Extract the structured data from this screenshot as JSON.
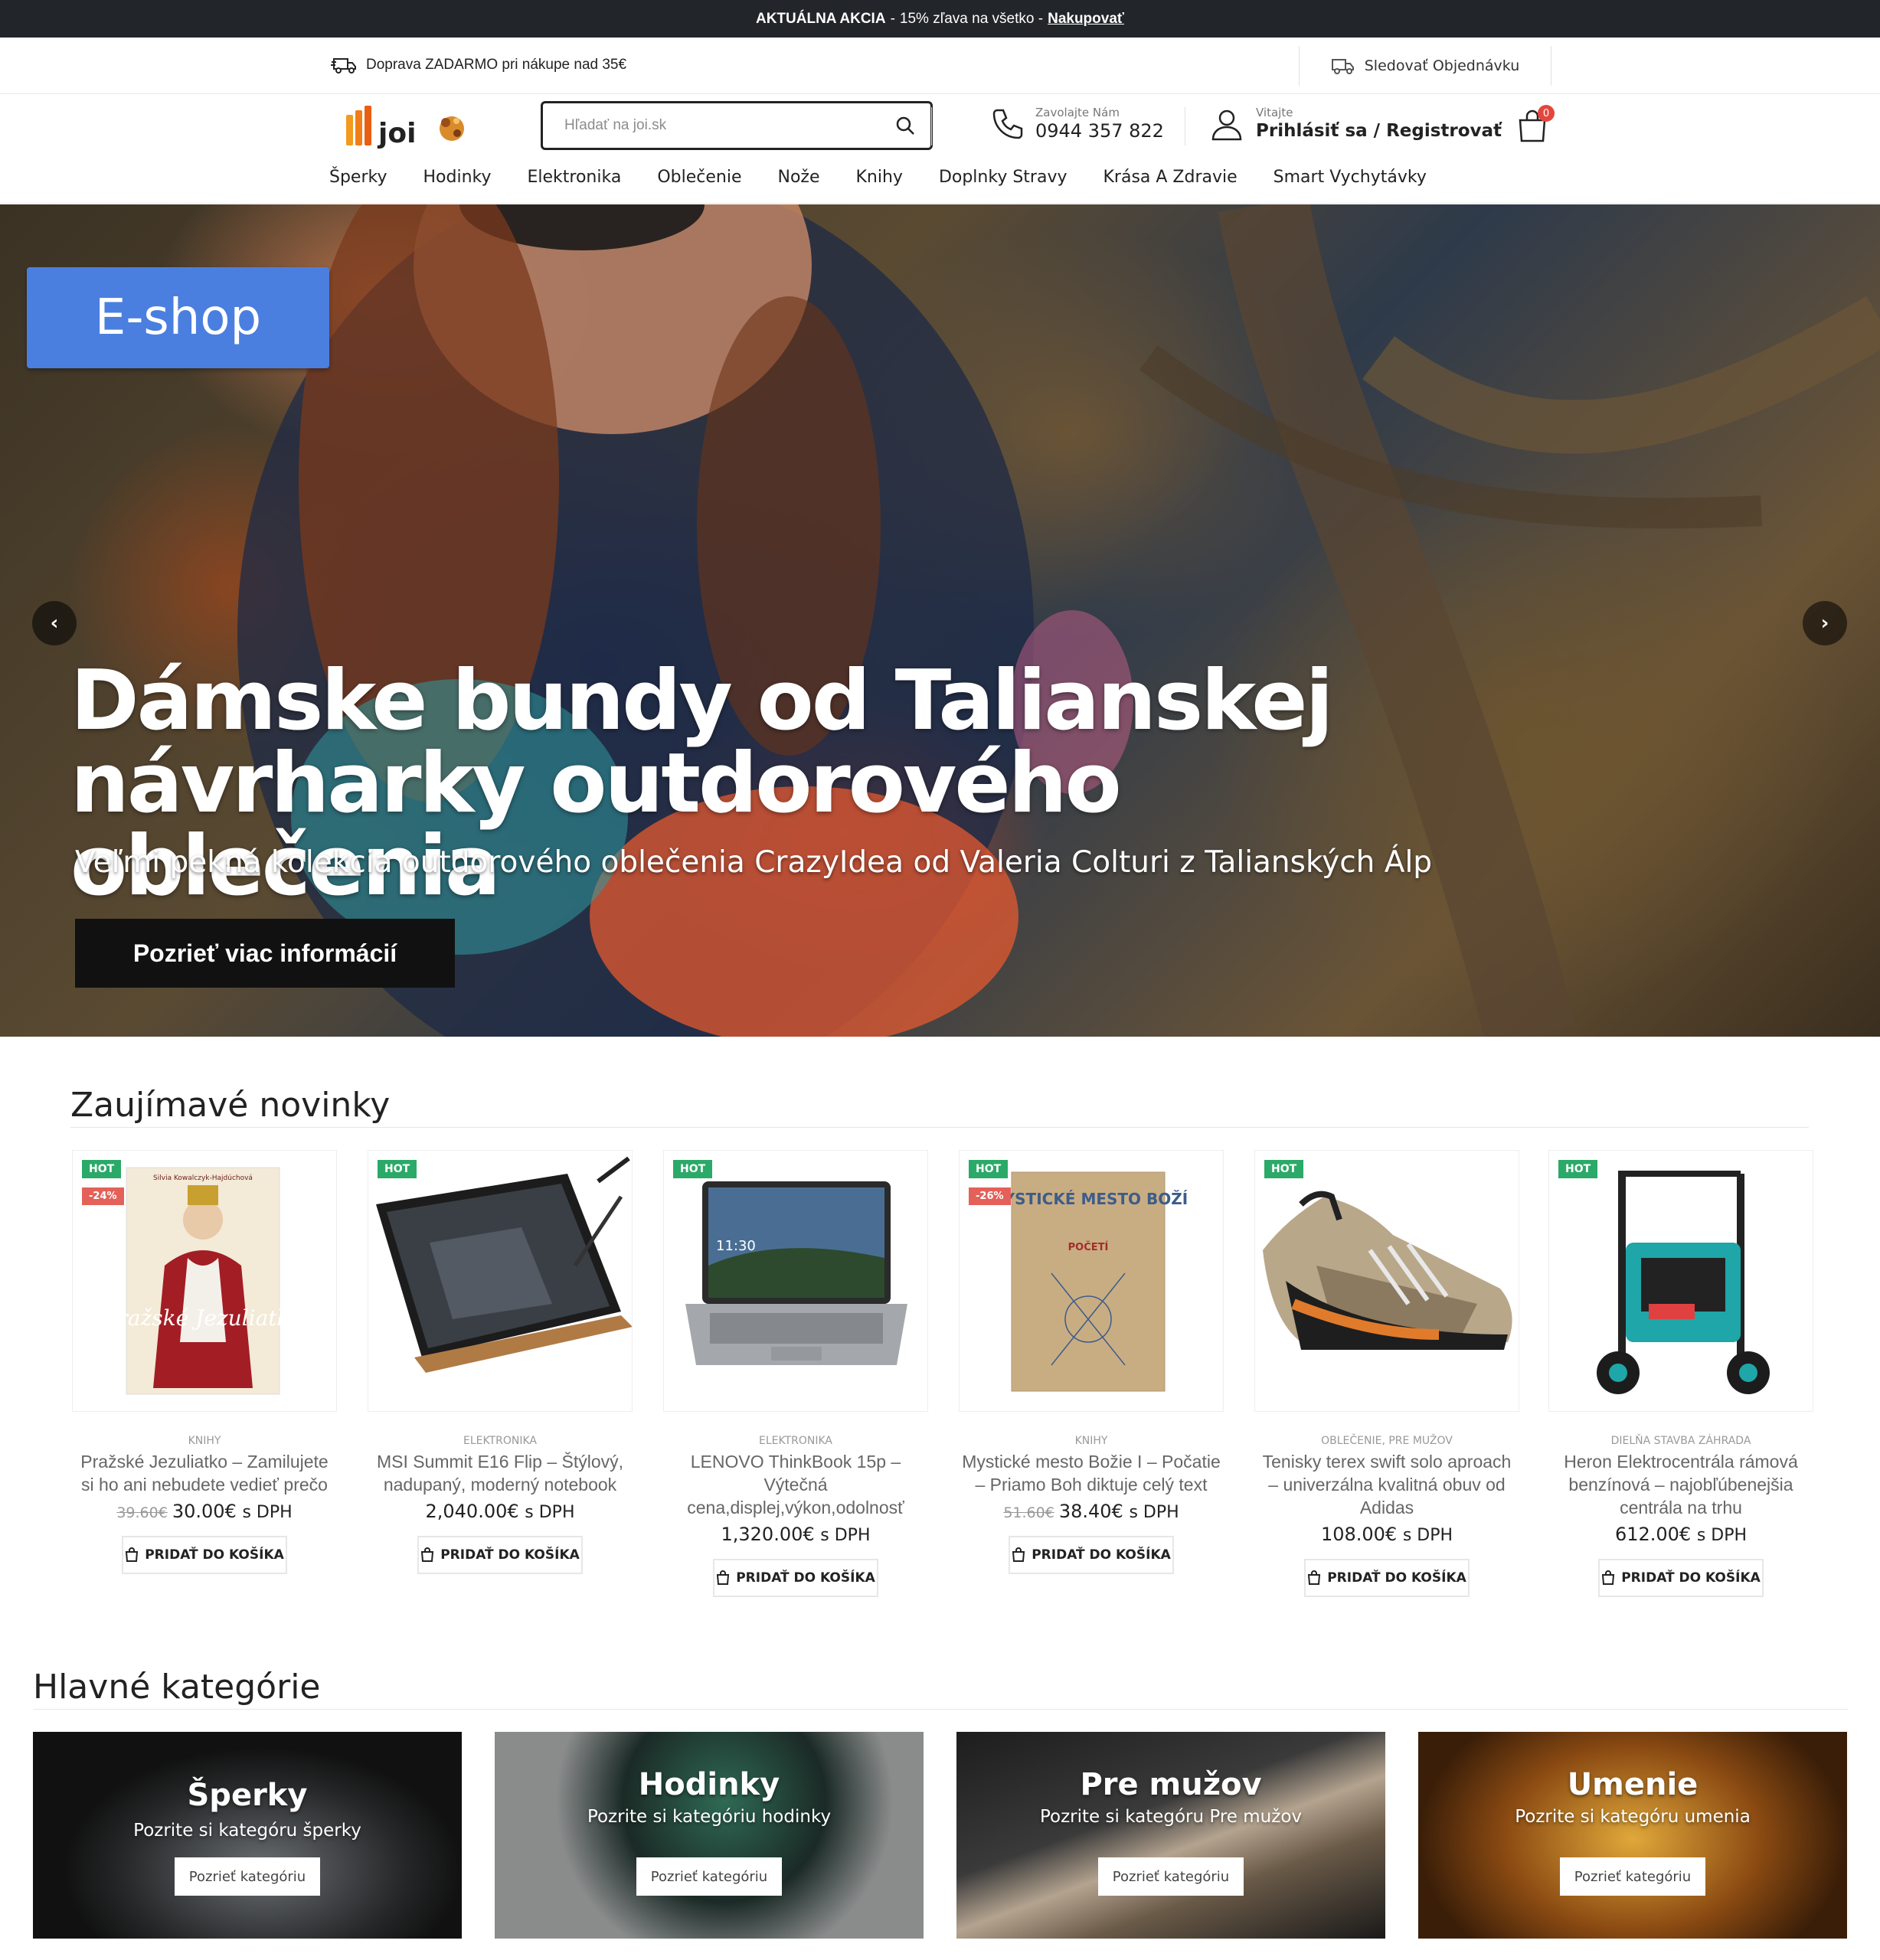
{
  "promo": {
    "label": "AKTUÁLNA AKCIA",
    "separator": "-",
    "text": "15% zľava na všetko -",
    "link": "Nakupovať"
  },
  "info_bar": {
    "shipping": "Doprava ZADARMO pri nákupe nad 35€",
    "track": "Sledovať Objednávku"
  },
  "header": {
    "search_placeholder": "Hľadať na joi.sk",
    "phone_label": "Zavolajte Nám",
    "phone_number": "0944 357 822",
    "account_label": "Vitajte",
    "account_link": "Prihlásiť sa / Registrovať",
    "cart_count": "0"
  },
  "nav": [
    "Šperky",
    "Hodinky",
    "Elektronika",
    "Oblečenie",
    "Nože",
    "Knihy",
    "Doplnky Stravy",
    "Krása A Zdravie",
    "Smart Vychytávky"
  ],
  "hero": {
    "badge": "E-shop",
    "title": "Dámske bundy od Talianskej návrharky outdorového oblečenia",
    "subtitle": "Veľmi pekná kolekcia outdorového oblečenia CrazyIdea od Valeria Colturi z Talianských Álp",
    "button": "Pozrieť viac informácií",
    "prev": "‹",
    "next": "›"
  },
  "novinky": {
    "title": "Zaujímavé novinky",
    "add_label": "PRIDAŤ DO KOŠÍKA",
    "products": [
      {
        "hot": "HOT",
        "sale": "-24%",
        "category": "KNIHY",
        "name": "Pražské Jezuliatko – Zamilujete si ho ani nebudete vedieť prečo",
        "old_price": "39.60€",
        "price": "30.00€",
        "dph": "s DPH"
      },
      {
        "hot": "HOT",
        "sale": "",
        "category": "ELEKTRONIKA",
        "name": "MSI Summit E16 Flip – Štýlový, nadupaný, moderný notebook",
        "old_price": "",
        "price": "2,040.00€",
        "dph": "s DPH"
      },
      {
        "hot": "HOT",
        "sale": "",
        "category": "ELEKTRONIKA",
        "name": "LENOVO ThinkBook 15p – Výtečná cena,displej,výkon,odolnosť",
        "old_price": "",
        "price": "1,320.00€",
        "dph": "s DPH"
      },
      {
        "hot": "HOT",
        "sale": "-26%",
        "category": "KNIHY",
        "name": "Mystické mesto Božie I – Počatie – Priamo Boh diktuje celý text",
        "old_price": "51.60€",
        "price": "38.40€",
        "dph": "s DPH"
      },
      {
        "hot": "HOT",
        "sale": "",
        "category": "OBLEČENIE, PRE MUŽOV",
        "name": "Tenisky terex swift solo aproach – univerzálna kvalitná obuv od Adidas",
        "old_price": "",
        "price": "108.00€",
        "dph": "s DPH"
      },
      {
        "hot": "HOT",
        "sale": "",
        "category": "DIELŇA STAVBA ZÁHRADA",
        "name": "Heron Elektrocentrála rámová benzínová – najobľúbenejšia centrála na trhu",
        "old_price": "",
        "price": "612.00€",
        "dph": "s DPH"
      }
    ]
  },
  "kategorie": {
    "title": "Hlavné kategórie",
    "button": "Pozrieť kategóriu",
    "items": [
      {
        "title": "Šperky",
        "desc": "Pozrite si kategóru šperky"
      },
      {
        "title": "Hodinky",
        "desc": "Pozrite si kategóriu hodinky"
      },
      {
        "title": "Pre mužov",
        "desc": "Pozrite si kategóru Pre mužov"
      },
      {
        "title": "Umenie",
        "desc": "Pozrite si kategóru umenia"
      }
    ]
  },
  "images": {
    "book1": {
      "top": "Silvia Kowalczyk-Hajdúchová",
      "title": "Pražské Jezuliatko"
    },
    "laptop2": {
      "clock": "11:30"
    },
    "book2": {
      "title": "MYSTICKÉ MESTO BOŽÍ",
      "sub": "POČETÍ"
    }
  }
}
